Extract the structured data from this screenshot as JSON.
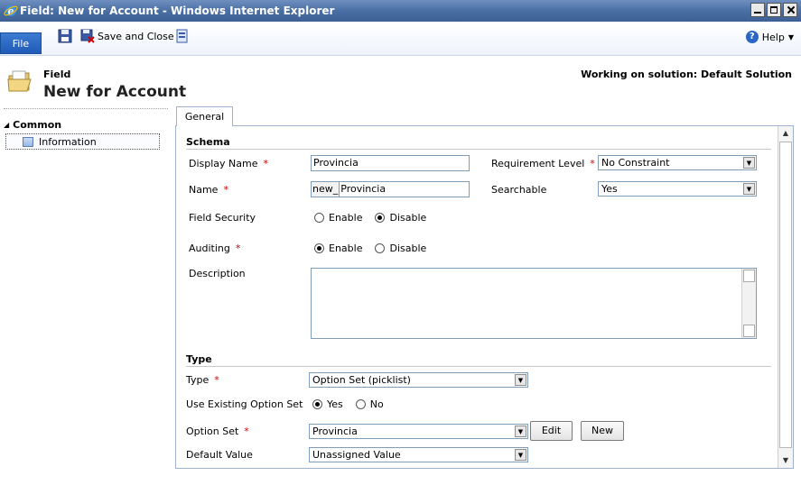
{
  "window": {
    "title": "Field: New for Account - Windows Internet Explorer"
  },
  "toolbar": {
    "file_label": "File",
    "save_close_label": "Save and Close",
    "help_label": "Help"
  },
  "header": {
    "entity_label": "Field",
    "entity_title": "New for Account",
    "solution_text": "Working on solution: Default Solution"
  },
  "nav": {
    "group_label": "Common",
    "items": [
      {
        "label": "Information"
      }
    ]
  },
  "tabs": [
    {
      "label": "General"
    }
  ],
  "schema": {
    "title": "Schema",
    "display_name_label": "Display Name",
    "display_name_value": "Provincia",
    "name_label": "Name",
    "name_prefix": "new_",
    "name_value": "Provincia",
    "requirement_label": "Requirement Level",
    "requirement_value": "No Constraint",
    "searchable_label": "Searchable",
    "searchable_value": "Yes",
    "field_security_label": "Field Security",
    "field_security_options": [
      "Enable",
      "Disable"
    ],
    "field_security_selected": "Disable",
    "auditing_label": "Auditing",
    "auditing_options": [
      "Enable",
      "Disable"
    ],
    "auditing_selected": "Enable",
    "description_label": "Description",
    "description_value": ""
  },
  "type": {
    "title": "Type",
    "type_label": "Type",
    "type_value": "Option Set (picklist)",
    "use_existing_label": "Use Existing Option Set",
    "use_existing_options": [
      "Yes",
      "No"
    ],
    "use_existing_selected": "Yes",
    "option_set_label": "Option Set",
    "option_set_value": "Provincia",
    "edit_label": "Edit",
    "new_label": "New",
    "default_value_label": "Default Value",
    "default_value_value": "Unassigned Value"
  },
  "required_marker": "*",
  "colors": {
    "titlebar": "#4a6fa5",
    "file_button": "#1f5bb8",
    "required": "#cc0000"
  }
}
